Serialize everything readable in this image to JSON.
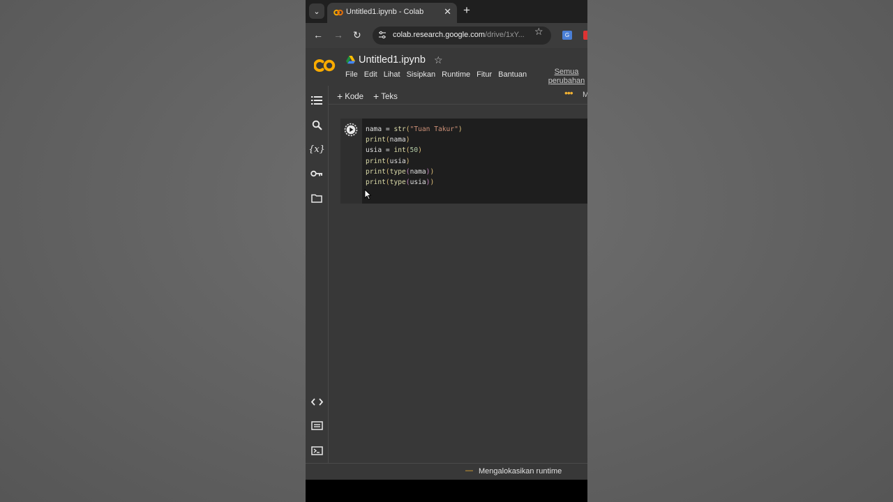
{
  "browser": {
    "tab": {
      "title": "Untitled1.ipynb - Colab"
    },
    "address": {
      "host": "colab.research.google.com",
      "path": "/drive/1xY..."
    }
  },
  "colab": {
    "notebook_title": "Untitled1.ipynb",
    "menu": [
      "File",
      "Edit",
      "Lihat",
      "Sisipkan",
      "Runtime",
      "Fitur",
      "Bantuan"
    ],
    "save_status": "Semua perubahan",
    "toolbar": {
      "add_code": "Kode",
      "add_text": "Teks",
      "edge_label": "M"
    },
    "rail_icons": [
      "table-of-contents-icon",
      "search-icon",
      "variables-icon",
      "secrets-key-icon",
      "files-folder-icon",
      "code-snippets-icon",
      "command-palette-icon",
      "terminal-icon"
    ],
    "cell": {
      "code_lines": [
        "nama = str(\"Tuan Takur\")",
        "print(nama)",
        "usia = int(50)",
        "print(usia)",
        "print(type(nama))",
        "print(type(usia))"
      ]
    },
    "status": {
      "text": "Mengalokasikan runtime"
    }
  },
  "colors": {
    "accent_orange": "#f1b132",
    "panel_bg": "#383838",
    "cell_bg": "#1e1e1e"
  }
}
